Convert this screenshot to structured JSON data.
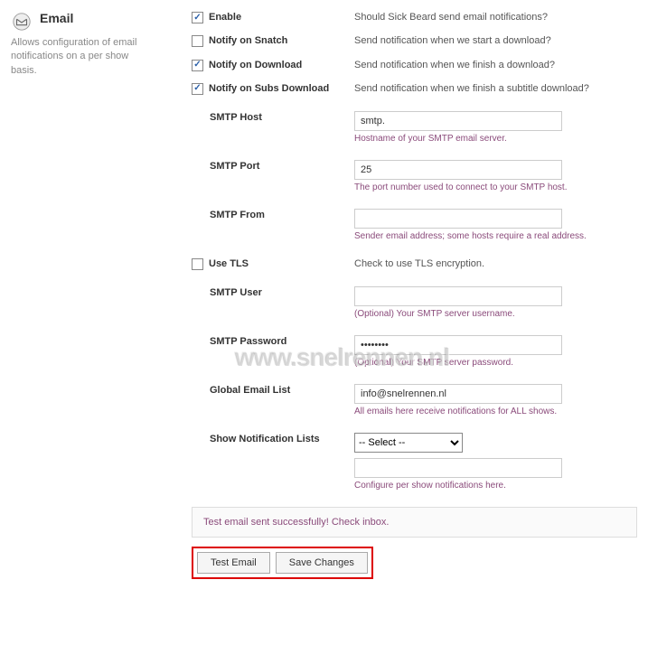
{
  "header": {
    "title": "Email",
    "desc": "Allows configuration of email notifications on a per show basis."
  },
  "fields": {
    "enable": {
      "label": "Enable",
      "desc": "Should Sick Beard send email notifications?",
      "checked": true
    },
    "snatch": {
      "label": "Notify on Snatch",
      "desc": "Send notification when we start a download?",
      "checked": false
    },
    "download": {
      "label": "Notify on Download",
      "desc": "Send notification when we finish a download?",
      "checked": true
    },
    "subs": {
      "label": "Notify on Subs Download",
      "desc": "Send notification when we finish a subtitle download?",
      "checked": true
    },
    "smtp_host": {
      "label": "SMTP Host",
      "value": "smtp.",
      "help": "Hostname of your SMTP email server."
    },
    "smtp_port": {
      "label": "SMTP Port",
      "value": "25",
      "help": "The port number used to connect to your SMTP host."
    },
    "smtp_from": {
      "label": "SMTP From",
      "value": "",
      "help": "Sender email address; some hosts require a real address."
    },
    "use_tls": {
      "label": "Use TLS",
      "desc": "Check to use TLS encryption.",
      "checked": false
    },
    "smtp_user": {
      "label": "SMTP User",
      "value": "",
      "help": "(Optional) Your SMTP server username."
    },
    "smtp_pass": {
      "label": "SMTP Password",
      "value": "••••••••",
      "help": "(Optional) Your SMTP server password."
    },
    "global_email": {
      "label": "Global Email List",
      "value": "info@snelrennen.nl",
      "help": "All emails here receive notifications for ALL shows."
    },
    "show_lists": {
      "label": "Show Notification Lists",
      "select": "-- Select --",
      "value": "",
      "help": "Configure per show notifications here."
    }
  },
  "status": "Test email sent successfully! Check inbox.",
  "buttons": {
    "test": "Test Email",
    "save": "Save Changes"
  },
  "watermark": "www.snelrennen.nl"
}
